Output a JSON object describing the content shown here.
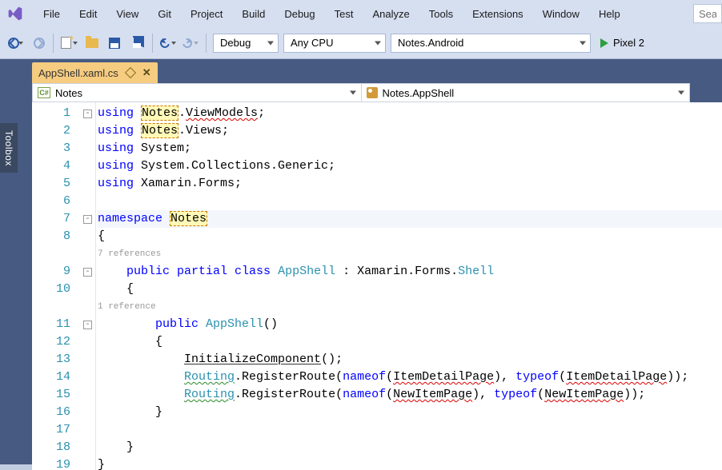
{
  "menu": [
    "File",
    "Edit",
    "View",
    "Git",
    "Project",
    "Build",
    "Debug",
    "Test",
    "Analyze",
    "Tools",
    "Extensions",
    "Window",
    "Help"
  ],
  "search_placeholder": "Search",
  "toolbar": {
    "config": "Debug",
    "platform": "Any CPU",
    "start_project": "Notes.Android",
    "start_target": "Pixel 2"
  },
  "sidepanel": {
    "toolbox": "Toolbox"
  },
  "doc_tab": {
    "title": "AppShell.xaml.cs"
  },
  "navbar": {
    "left": "Notes",
    "right": "Notes.AppShell"
  },
  "code": {
    "lines": [
      1,
      2,
      3,
      4,
      5,
      6,
      7,
      8,
      9,
      10,
      11,
      12,
      13,
      14,
      15,
      16,
      17,
      18,
      19
    ],
    "fold": {
      "1": "-",
      "7": "-",
      "9": "-",
      "11": "-"
    },
    "ref1": "7 references",
    "ref2": "1 reference",
    "l1_a": "using ",
    "l1_b": "Notes",
    "l1_c": ".",
    "l1_d": "ViewModels",
    "l1_e": ";",
    "l2_a": "using ",
    "l2_b": "Notes",
    "l2_c": ".Views;",
    "l3_a": "using ",
    "l3_b": "System;",
    "l4_a": "using ",
    "l4_b": "System.Collections.Generic;",
    "l5_a": "using ",
    "l5_b": "Xamarin.Forms;",
    "l7_a": "namespace ",
    "l7_b": "Notes",
    "l8": "{",
    "l9_a": "    public ",
    "l9_b": "partial ",
    "l9_c": "class ",
    "l9_d": "AppShell",
    "l9_e": " : Xamarin.Forms.",
    "l9_f": "Shell",
    "l10": "    {",
    "l11_a": "        public ",
    "l11_b": "AppShell",
    "l11_c": "()",
    "l12": "        {",
    "l13_a": "            ",
    "l13_b": "InitializeComponent",
    "l13_c": "();",
    "l14_a": "            ",
    "l14_b": "Routing",
    "l14_c": ".RegisterRoute(",
    "l14_d": "nameof",
    "l14_e": "(",
    "l14_f": "ItemDetailPage",
    "l14_g": "), ",
    "l14_h": "typeof",
    "l14_i": "(",
    "l14_j": "ItemDetailPage",
    "l14_k": "));",
    "l15_a": "            ",
    "l15_b": "Routing",
    "l15_c": ".RegisterRoute(",
    "l15_d": "nameof",
    "l15_e": "(",
    "l15_f": "NewItemPage",
    "l15_g": "), ",
    "l15_h": "typeof",
    "l15_i": "(",
    "l15_j": "NewItemPage",
    "l15_k": "));",
    "l16": "        }",
    "l18": "    }",
    "l19": "}"
  }
}
